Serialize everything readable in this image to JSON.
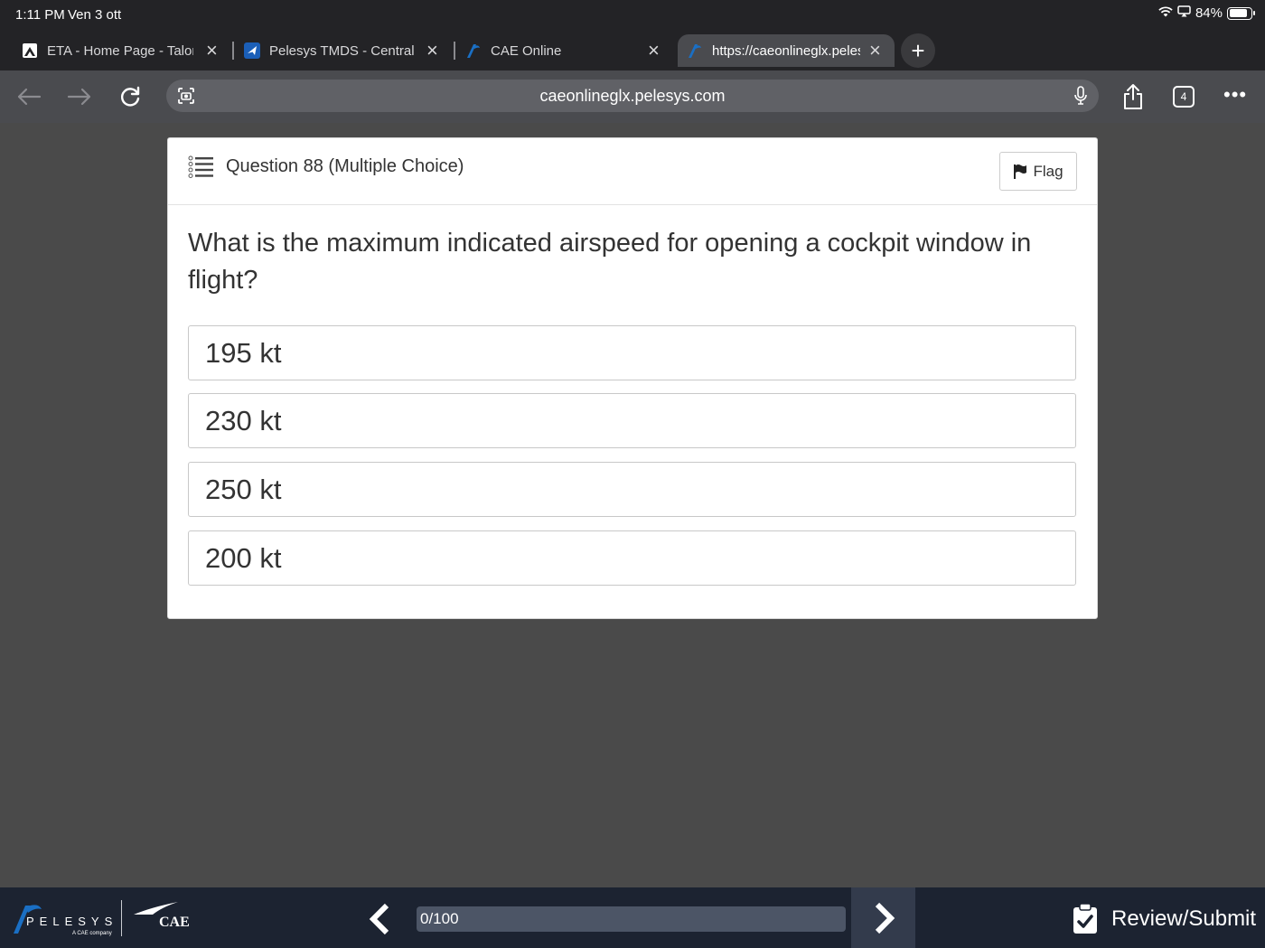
{
  "status_bar": {
    "time": "1:11 PM",
    "date": "Ven 3 ott",
    "battery": "84%",
    "battery_level": 0.84
  },
  "tabs": [
    {
      "label": "ETA - Home Page - Talon",
      "icon": "home-app-icon"
    },
    {
      "label": "Pelesys TMDS - Central",
      "icon": "plane-icon"
    },
    {
      "label": "CAE Online",
      "icon": "pelesys-favicon"
    },
    {
      "label": "https://caeonlineglx.pelesys.com",
      "icon": "pelesys-favicon",
      "active": true
    }
  ],
  "toolbar": {
    "url": "caeonlineglx.pelesys.com",
    "tab_count": "4"
  },
  "question": {
    "title": "Question 88 (Multiple Choice)",
    "flag_label": "Flag",
    "text": "What is the maximum indicated airspeed for opening a cockpit window in flight?",
    "choices": [
      "195 kt",
      "230 kt",
      "250 kt",
      "200 kt"
    ]
  },
  "footer": {
    "brand_pelesys": "PELESYS",
    "brand_pelesys_sub": "A CAE company",
    "brand_cae": "CAE",
    "progress_label": "0/100",
    "progress_value": 0,
    "review_label": "Review/Submit"
  },
  "colors": {
    "chrome_dark": "#232326",
    "toolbar": "#4a4b4f",
    "page_bg": "#4a4a4a",
    "footer_bg": "#1c2331",
    "pelesys_blue": "#1a6fc4"
  }
}
